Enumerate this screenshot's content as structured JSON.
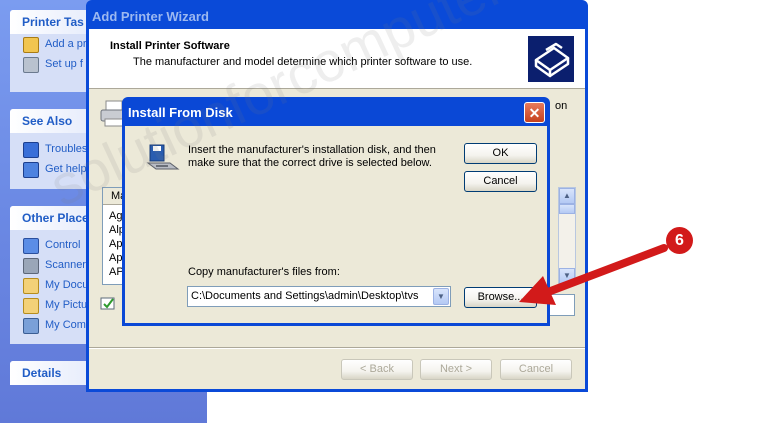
{
  "taskpane": {
    "printer_tasks": {
      "title": "Printer Tas",
      "items": [
        "Add a pr",
        "Set up f"
      ]
    },
    "see_also": {
      "title": "See Also",
      "items": [
        "Troubles",
        "Get help"
      ]
    },
    "other_places": {
      "title": "Other Place",
      "items": [
        "Control",
        "Scanner",
        "My Docu",
        "My Pictu",
        "My Comp"
      ]
    },
    "details": {
      "title": "Details"
    }
  },
  "wizard": {
    "title": "Add Printer Wizard",
    "header_title": "Install Printer Software",
    "header_subtitle": "The manufacturer and model determine which printer software to use.",
    "partial_text": "on",
    "manufacturer_list": {
      "header": "Ma",
      "items": [
        "Agf",
        "Alp",
        "Ape",
        "App",
        "AP"
      ]
    },
    "buttons": {
      "back": "< Back",
      "next": "Next >",
      "cancel": "Cancel"
    }
  },
  "dialog": {
    "title": "Install From Disk",
    "close_glyph": "✕",
    "message": "Insert the manufacturer's installation disk, and then make sure that the correct drive is selected below.",
    "ok_label": "OK",
    "cancel_label": "Cancel",
    "copy_label": "Copy manufacturer's files from:",
    "path_value": "C:\\Documents and Settings\\admin\\Desktop\\tvs",
    "browse_label": "Browse..."
  },
  "annotation": {
    "step_number": "6",
    "color": "#d21a1a"
  },
  "watermark": "solutionforcomputer.com",
  "colors": {
    "title_bar": "#0a48d6",
    "dialog_face": "#ece9d8",
    "link_blue": "#215dc6"
  }
}
